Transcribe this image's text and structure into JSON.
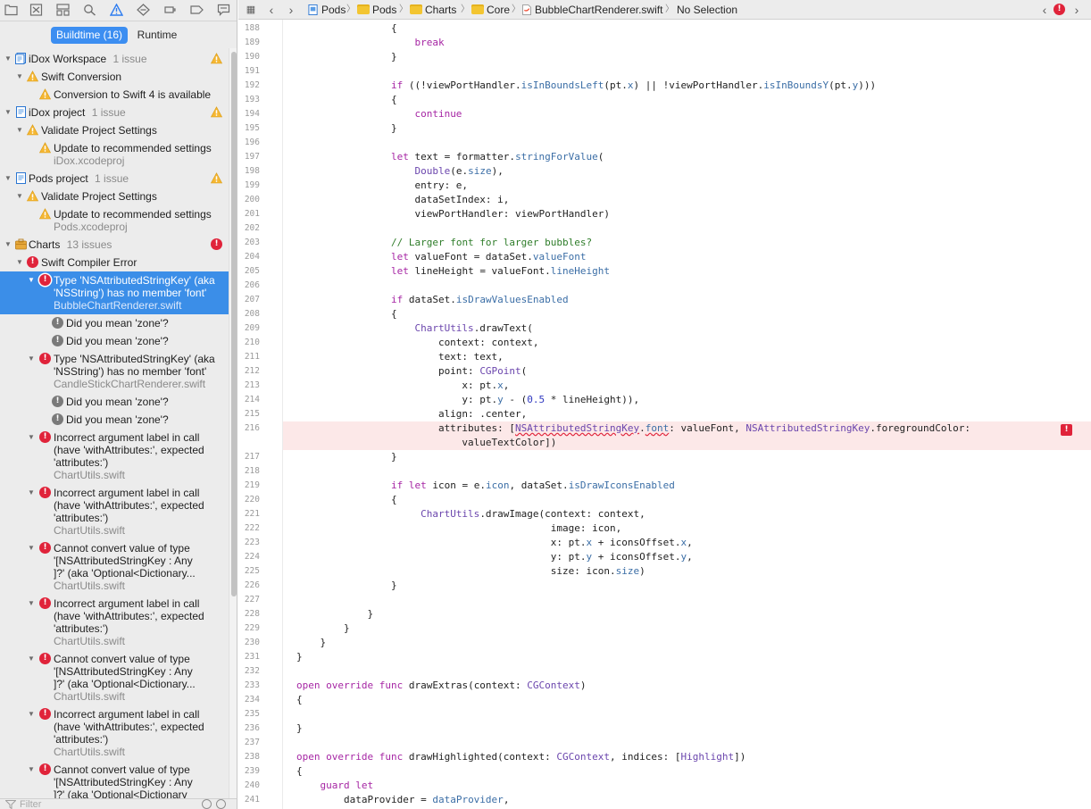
{
  "navigator": {
    "scope_tabs": {
      "buildtime": "Buildtime (16)",
      "runtime": "Runtime"
    },
    "filter_placeholder": "Filter",
    "issues": [
      {
        "kind": "group",
        "icon": "workspace-icon",
        "title": "iDox Workspace",
        "count": "1 issue",
        "status": "warning"
      },
      {
        "kind": "category",
        "icon": "warning-icon",
        "title": "Swift Conversion"
      },
      {
        "kind": "issue",
        "icon": "warning-icon",
        "title": "Conversion to Swift 4 is available"
      },
      {
        "kind": "group",
        "icon": "project-icon",
        "title": "iDox project",
        "count": "1 issue",
        "status": "warning"
      },
      {
        "kind": "category",
        "icon": "warning-icon",
        "title": "Validate Project Settings"
      },
      {
        "kind": "issue",
        "icon": "warning-icon",
        "title": "Update to recommended settings",
        "file": "iDox.xcodeproj"
      },
      {
        "kind": "group",
        "icon": "project-icon",
        "title": "Pods project",
        "count": "1 issue",
        "status": "warning"
      },
      {
        "kind": "category",
        "icon": "warning-icon",
        "title": "Validate Project Settings"
      },
      {
        "kind": "issue",
        "icon": "warning-icon",
        "title": "Update to recommended settings",
        "file": "Pods.xcodeproj"
      },
      {
        "kind": "group",
        "icon": "package-icon",
        "title": "Charts",
        "count": "13 issues",
        "status": "error"
      },
      {
        "kind": "category",
        "icon": "error-icon",
        "title": "Swift Compiler Error"
      },
      {
        "kind": "issue",
        "icon": "error-icon",
        "selected": true,
        "lines": [
          "Type 'NSAttributedStringKey' (aka",
          "'NSString') has no member 'font'"
        ],
        "file": "BubbleChartRenderer.swift"
      },
      {
        "kind": "note",
        "title": "Did you mean 'zone'?"
      },
      {
        "kind": "note",
        "title": "Did you mean 'zone'?"
      },
      {
        "kind": "issue",
        "icon": "error-icon",
        "lines": [
          "Type 'NSAttributedStringKey' (aka",
          "'NSString') has no member 'font'"
        ],
        "file": "CandleStickChartRenderer.swift"
      },
      {
        "kind": "note",
        "title": "Did you mean 'zone'?"
      },
      {
        "kind": "note",
        "title": "Did you mean 'zone'?"
      },
      {
        "kind": "issue",
        "icon": "error-icon",
        "lines": [
          "Incorrect argument label in call",
          "(have 'withAttributes:', expected",
          "'attributes:')"
        ],
        "file": "ChartUtils.swift"
      },
      {
        "kind": "issue",
        "icon": "error-icon",
        "lines": [
          "Incorrect argument label in call",
          "(have 'withAttributes:', expected",
          "'attributes:')"
        ],
        "file": "ChartUtils.swift"
      },
      {
        "kind": "issue",
        "icon": "error-icon",
        "lines": [
          "Cannot convert value of type",
          "'[NSAttributedStringKey : Any",
          "]?' (aka 'Optional<Dictionary..."
        ],
        "file": "ChartUtils.swift"
      },
      {
        "kind": "issue",
        "icon": "error-icon",
        "lines": [
          "Incorrect argument label in call",
          "(have 'withAttributes:', expected",
          "'attributes:')"
        ],
        "file": "ChartUtils.swift"
      },
      {
        "kind": "issue",
        "icon": "error-icon",
        "lines": [
          "Cannot convert value of type",
          "'[NSAttributedStringKey : Any",
          "]?' (aka 'Optional<Dictionary..."
        ],
        "file": "ChartUtils.swift"
      },
      {
        "kind": "issue",
        "icon": "error-icon",
        "lines": [
          "Incorrect argument label in call",
          "(have 'withAttributes:', expected",
          "'attributes:')"
        ],
        "file": "ChartUtils.swift"
      },
      {
        "kind": "issue",
        "icon": "error-icon",
        "lines": [
          "Cannot convert value of type",
          "'[NSAttributedStringKey : Any",
          "]?' (aka 'Optional<Dictionary"
        ]
      }
    ]
  },
  "jumpbar": {
    "crumbs": [
      "Pods",
      "Pods",
      "Charts",
      "Core",
      "BubbleChartRenderer.swift",
      "No Selection"
    ]
  },
  "editor": {
    "error_line": "216",
    "lines": [
      {
        "n": "188",
        "t": [
          [
            "",
            "                {"
          ]
        ]
      },
      {
        "n": "189",
        "t": [
          [
            "",
            "                    "
          ],
          [
            "kw",
            "break"
          ]
        ]
      },
      {
        "n": "190",
        "t": [
          [
            "",
            "                }"
          ]
        ]
      },
      {
        "n": "191",
        "t": []
      },
      {
        "n": "192",
        "t": [
          [
            "",
            "                "
          ],
          [
            "kw",
            "if"
          ],
          [
            "",
            " ((!viewPortHandler."
          ],
          [
            "pr",
            "isInBoundsLeft"
          ],
          [
            "",
            "(pt."
          ],
          [
            "pr",
            "x"
          ],
          [
            "",
            ") || !viewPortHandler."
          ],
          [
            "pr",
            "isInBoundsY"
          ],
          [
            "",
            "(pt."
          ],
          [
            "pr",
            "y"
          ],
          [
            "",
            ")))"
          ]
        ]
      },
      {
        "n": "193",
        "t": [
          [
            "",
            "                {"
          ]
        ]
      },
      {
        "n": "194",
        "t": [
          [
            "",
            "                    "
          ],
          [
            "kw",
            "continue"
          ]
        ]
      },
      {
        "n": "195",
        "t": [
          [
            "",
            "                }"
          ]
        ]
      },
      {
        "n": "196",
        "t": []
      },
      {
        "n": "197",
        "t": [
          [
            "",
            "                "
          ],
          [
            "kw",
            "let"
          ],
          [
            "",
            " text = formatter."
          ],
          [
            "pr",
            "stringForValue"
          ],
          [
            "",
            "("
          ]
        ]
      },
      {
        "n": "198",
        "t": [
          [
            "",
            "                    "
          ],
          [
            "ty",
            "Double"
          ],
          [
            "",
            "(e."
          ],
          [
            "pr",
            "size"
          ],
          [
            "",
            "),"
          ]
        ]
      },
      {
        "n": "199",
        "t": [
          [
            "",
            "                    entry: e,"
          ]
        ]
      },
      {
        "n": "200",
        "t": [
          [
            "",
            "                    dataSetIndex: i,"
          ]
        ]
      },
      {
        "n": "201",
        "t": [
          [
            "",
            "                    viewPortHandler: viewPortHandler)"
          ]
        ]
      },
      {
        "n": "202",
        "t": []
      },
      {
        "n": "203",
        "t": [
          [
            "",
            "                "
          ],
          [
            "cm",
            "// Larger font for larger bubbles?"
          ]
        ]
      },
      {
        "n": "204",
        "t": [
          [
            "",
            "                "
          ],
          [
            "kw",
            "let"
          ],
          [
            "",
            " valueFont = dataSet."
          ],
          [
            "pr",
            "valueFont"
          ]
        ]
      },
      {
        "n": "205",
        "t": [
          [
            "",
            "                "
          ],
          [
            "kw",
            "let"
          ],
          [
            "",
            " lineHeight = valueFont."
          ],
          [
            "pr",
            "lineHeight"
          ]
        ]
      },
      {
        "n": "206",
        "t": []
      },
      {
        "n": "207",
        "t": [
          [
            "",
            "                "
          ],
          [
            "kw",
            "if"
          ],
          [
            "",
            " dataSet."
          ],
          [
            "pr",
            "isDrawValuesEnabled"
          ]
        ]
      },
      {
        "n": "208",
        "t": [
          [
            "",
            "                {"
          ]
        ]
      },
      {
        "n": "209",
        "t": [
          [
            "",
            "                    "
          ],
          [
            "ty",
            "ChartUtils"
          ],
          [
            "",
            ".drawText("
          ]
        ]
      },
      {
        "n": "210",
        "t": [
          [
            "",
            "                        context: context,"
          ]
        ]
      },
      {
        "n": "211",
        "t": [
          [
            "",
            "                        text: text,"
          ]
        ]
      },
      {
        "n": "212",
        "t": [
          [
            "",
            "                        point: "
          ],
          [
            "ty",
            "CGPoint"
          ],
          [
            "",
            "("
          ]
        ]
      },
      {
        "n": "213",
        "t": [
          [
            "",
            "                            x: pt."
          ],
          [
            "pr",
            "x"
          ],
          [
            "",
            ","
          ]
        ]
      },
      {
        "n": "214",
        "t": [
          [
            "",
            "                            y: pt."
          ],
          [
            "pr",
            "y"
          ],
          [
            "",
            " - ("
          ],
          [
            "nu",
            "0.5"
          ],
          [
            "",
            " * lineHeight)),"
          ]
        ]
      },
      {
        "n": "215",
        "t": [
          [
            "",
            "                        align: .center,"
          ]
        ]
      },
      {
        "n": "216",
        "t": [
          [
            "",
            "                        attributes: ["
          ],
          [
            "ty squiggle",
            "NSAttributedStringKey"
          ],
          [
            "",
            "."
          ],
          [
            "pr squiggle",
            "font"
          ],
          [
            "",
            ": valueFont, "
          ],
          [
            "ty",
            "NSAttributedStringKey"
          ],
          [
            "",
            ".foregroundColor:"
          ]
        ]
      },
      {
        "n": "",
        "t": [
          [
            "",
            "                            valueTextColor])"
          ]
        ]
      },
      {
        "n": "217",
        "t": [
          [
            "",
            "                }"
          ]
        ]
      },
      {
        "n": "218",
        "t": []
      },
      {
        "n": "219",
        "t": [
          [
            "",
            "                "
          ],
          [
            "kw",
            "if let"
          ],
          [
            "",
            " icon = e."
          ],
          [
            "pr",
            "icon"
          ],
          [
            "",
            ", dataSet."
          ],
          [
            "pr",
            "isDrawIconsEnabled"
          ]
        ]
      },
      {
        "n": "220",
        "t": [
          [
            "",
            "                {"
          ]
        ]
      },
      {
        "n": "221",
        "t": [
          [
            "",
            "                     "
          ],
          [
            "ty",
            "ChartUtils"
          ],
          [
            "",
            ".drawImage(context: context,"
          ]
        ]
      },
      {
        "n": "222",
        "t": [
          [
            "",
            "                                           image: icon,"
          ]
        ]
      },
      {
        "n": "223",
        "t": [
          [
            "",
            "                                           x: pt."
          ],
          [
            "pr",
            "x"
          ],
          [
            "",
            " + iconsOffset."
          ],
          [
            "pr",
            "x"
          ],
          [
            "",
            ","
          ]
        ]
      },
      {
        "n": "224",
        "t": [
          [
            "",
            "                                           y: pt."
          ],
          [
            "pr",
            "y"
          ],
          [
            "",
            " + iconsOffset."
          ],
          [
            "pr",
            "y"
          ],
          [
            "",
            ","
          ]
        ]
      },
      {
        "n": "225",
        "t": [
          [
            "",
            "                                           size: icon."
          ],
          [
            "pr",
            "size"
          ],
          [
            "",
            ")"
          ]
        ]
      },
      {
        "n": "226",
        "t": [
          [
            "",
            "                }"
          ]
        ]
      },
      {
        "n": "227",
        "t": []
      },
      {
        "n": "228",
        "t": [
          [
            "",
            "            }"
          ]
        ]
      },
      {
        "n": "229",
        "t": [
          [
            "",
            "        }"
          ]
        ]
      },
      {
        "n": "230",
        "t": [
          [
            "",
            "    }"
          ]
        ]
      },
      {
        "n": "231",
        "t": [
          [
            "",
            "}"
          ]
        ]
      },
      {
        "n": "232",
        "t": []
      },
      {
        "n": "233",
        "t": [
          [
            "kw",
            "open override func"
          ],
          [
            "",
            " drawExtras(context: "
          ],
          [
            "ty",
            "CGContext"
          ],
          [
            "",
            ")"
          ]
        ]
      },
      {
        "n": "234",
        "t": [
          [
            "",
            "{"
          ]
        ]
      },
      {
        "n": "235",
        "t": []
      },
      {
        "n": "236",
        "t": [
          [
            "",
            "}"
          ]
        ]
      },
      {
        "n": "237",
        "t": []
      },
      {
        "n": "238",
        "t": [
          [
            "kw",
            "open override func"
          ],
          [
            "",
            " drawHighlighted(context: "
          ],
          [
            "ty",
            "CGContext"
          ],
          [
            "",
            ", indices: ["
          ],
          [
            "ty",
            "Highlight"
          ],
          [
            "",
            "])"
          ]
        ]
      },
      {
        "n": "239",
        "t": [
          [
            "",
            "{"
          ]
        ]
      },
      {
        "n": "240",
        "t": [
          [
            "",
            "    "
          ],
          [
            "kw",
            "guard let"
          ]
        ]
      },
      {
        "n": "241",
        "t": [
          [
            "",
            "        dataProvider = "
          ],
          [
            "pr",
            "dataProvider"
          ],
          [
            "",
            ","
          ]
        ]
      }
    ]
  }
}
